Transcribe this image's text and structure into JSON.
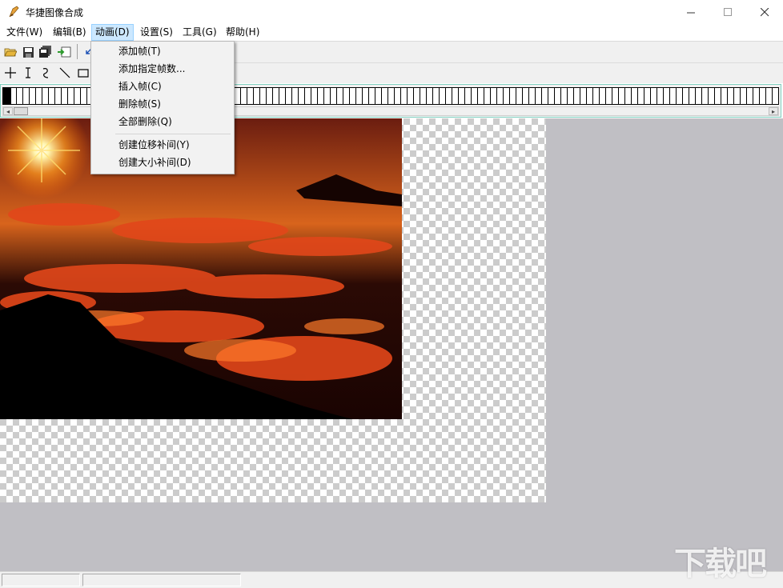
{
  "window": {
    "title": "华捷图像合成",
    "controls": {
      "minimize": "—",
      "maximize": "☐",
      "close": "✕"
    }
  },
  "menubar": {
    "items": [
      {
        "label": "文件(W)"
      },
      {
        "label": "编辑(B)"
      },
      {
        "label": "动画(D)",
        "active": true
      },
      {
        "label": "设置(S)"
      },
      {
        "label": "工具(G)"
      },
      {
        "label": "帮助(H)"
      }
    ]
  },
  "animation_menu": {
    "items": [
      {
        "label": "添加帧(T)"
      },
      {
        "label": "添加指定帧数..."
      },
      {
        "label": "插入帧(C)"
      },
      {
        "label": "删除帧(S)"
      },
      {
        "label": "全部删除(Q)"
      },
      {
        "label": "创建位移补间(Y)"
      },
      {
        "label": "创建大小补间(D)"
      }
    ]
  },
  "toolbar": {
    "file_icons": [
      "open-folder-icon",
      "save-icon",
      "save-all-icon",
      "import-frame-icon",
      "undo-icon"
    ],
    "draw_tools": [
      "crosshair-icon",
      "text-cursor-icon",
      "curve-icon",
      "line-icon",
      "rectangle-icon"
    ]
  },
  "colors": {
    "workspace": "#c0bfc4",
    "menu_highlight": "#cce8ff",
    "framestrip_border": "#7fd0c0"
  },
  "watermark": {
    "text": "下载吧"
  }
}
